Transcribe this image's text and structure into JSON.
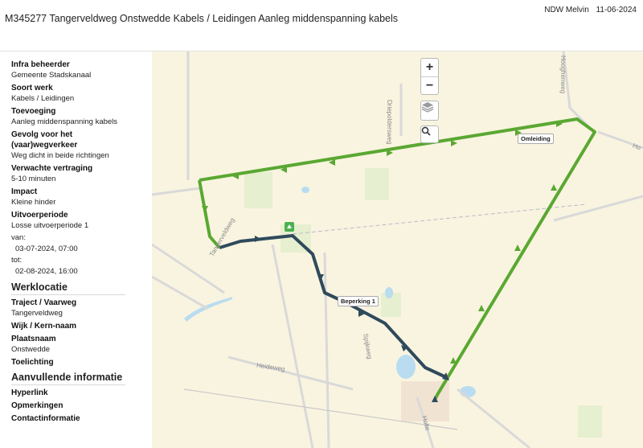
{
  "header": {
    "title": "M345277 Tangerveldweg Onstwedde Kabels / Leidingen Aanleg middenspanning kabels",
    "source": "NDW Melvin",
    "date": "11-06-2024"
  },
  "details": {
    "infra_label": "Infra beheerder",
    "infra_value": "Gemeente Stadskanaal",
    "soort_label": "Soort werk",
    "soort_value": "Kabels / Leidingen",
    "toevoeging_label": "Toevoeging",
    "toevoeging_value": "Aanleg middenspanning kabels",
    "gevolg_label_1": "Gevolg voor het",
    "gevolg_label_2": "(vaar)wegverkeer",
    "gevolg_value": "Weg dicht in beide richtingen",
    "vertraging_label": "Verwachte vertraging",
    "vertraging_value": "5-10 minuten",
    "impact_label": "Impact",
    "impact_value": "Kleine hinder",
    "periode_label": "Uitvoerperiode",
    "periode_value": "Losse uitvoerperiode 1",
    "van_label": "van:",
    "van_value": "03-07-2024, 07:00",
    "tot_label": "tot:",
    "tot_value": "02-08-2024, 16:00"
  },
  "werklocatie": {
    "heading": "Werklocatie",
    "traject_label": "Traject / Vaarweg",
    "traject_value": "Tangerveldweg",
    "wijk_label": "Wijk / Kern-naam",
    "plaats_label": "Plaatsnaam",
    "plaats_value": "Onstwedde",
    "toelichting_label": "Toelichting"
  },
  "aanvullend": {
    "heading": "Aanvullende informatie",
    "hyperlink_label": "Hyperlink",
    "opmerkingen_label": "Opmerkingen",
    "contact_label": "Contactinformatie"
  },
  "map": {
    "zoom_in": "+",
    "zoom_out": "−",
    "layers_icon": "layers-icon",
    "search_icon": "magnifier-icon",
    "label_detour": "Omleiding",
    "label_restriction": "Beperking 1",
    "road_labels": [
      "Driepoldersweg",
      "Heideweg",
      "Spijkweg",
      "Tangerveldweg",
      "Hooghenweg",
      "Holte",
      "Ho"
    ],
    "detour_color": "#5aa832",
    "restriction_color": "#2f4a5c"
  }
}
